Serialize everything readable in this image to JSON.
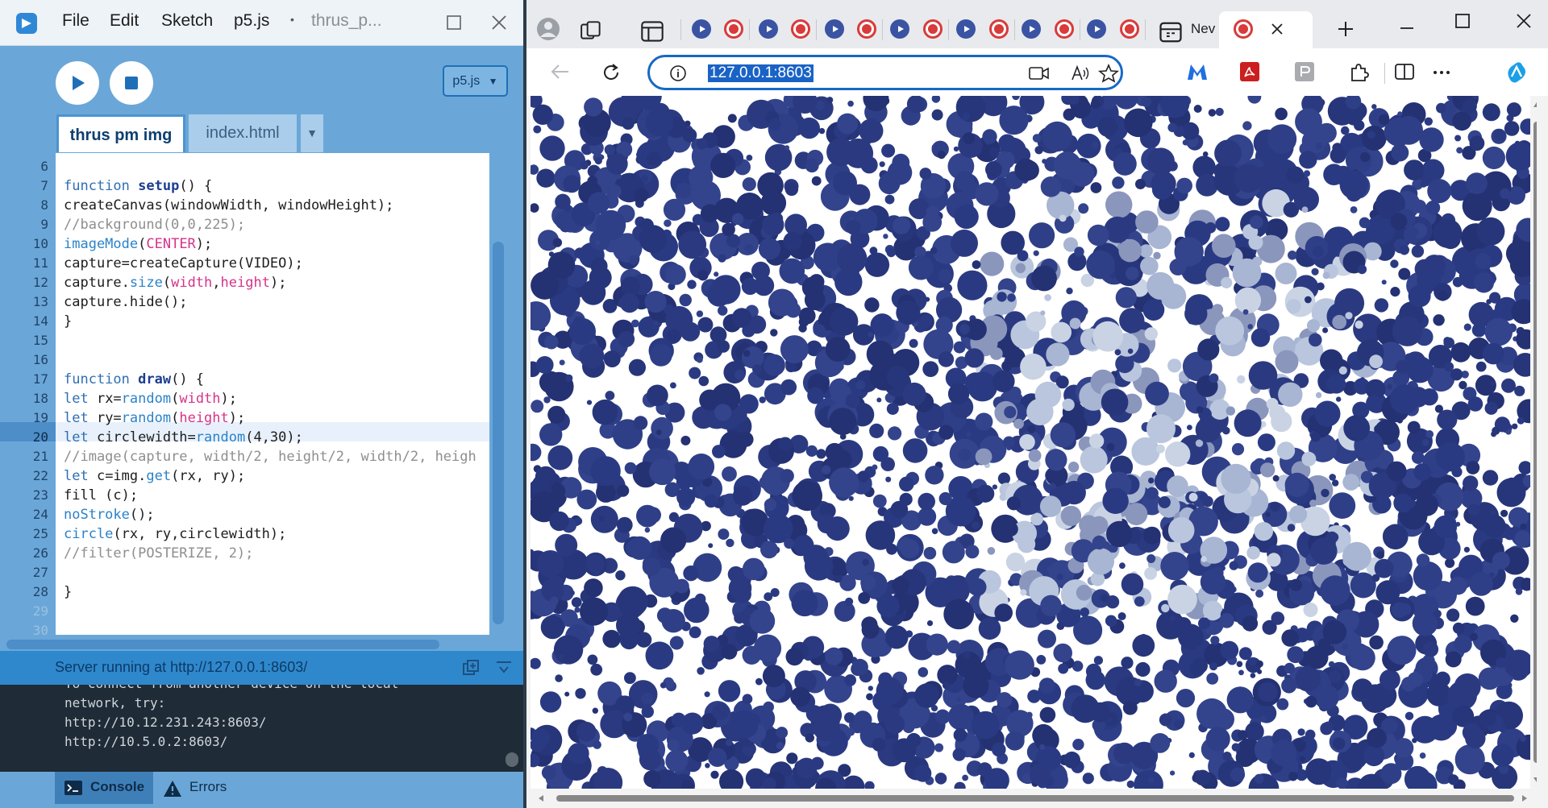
{
  "editor": {
    "menu": [
      "File",
      "Edit",
      "Sketch",
      "p5.js"
    ],
    "window_title": "thrus_p...",
    "mode": "p5.js",
    "tabs": [
      {
        "label": "thrus pm img",
        "active": true
      },
      {
        "label": "index.html",
        "active": false
      }
    ],
    "code": {
      "first_line_number": 6,
      "active_line_number": 20,
      "line_numbers": [
        "6",
        "7",
        "8",
        "9",
        "10",
        "11",
        "12",
        "13",
        "14",
        "15",
        "16",
        "17",
        "18",
        "19",
        "20",
        "21",
        "22",
        "23",
        "24",
        "25",
        "26",
        "27",
        "28",
        "29",
        "30"
      ],
      "lines": [
        "",
        "function setup() {",
        "createCanvas(windowWidth, windowHeight);",
        "//background(0,0,225);",
        "imageMode(CENTER);",
        "capture=createCapture(VIDEO);",
        "capture.size(width,height);",
        "capture.hide();",
        "}",
        "",
        "",
        "function draw() {",
        "let rx=random(width);",
        "let ry=random(height);",
        "let circlewidth=random(4,30);",
        "//image(capture, width/2, height/2, width/2, heigh",
        "let c=img.get(rx, ry);",
        "fill (c);",
        "noStroke();",
        "circle(rx, ry,circlewidth);",
        "//filter(POSTERIZE, 2);",
        "",
        "}",
        "",
        ""
      ]
    },
    "console": {
      "status": "Server running at http://127.0.0.1:8603/",
      "lines": [
        "To connect from another device on the local",
        "network, try:",
        "http://10.12.231.243:8603/",
        "http://10.5.0.2:8603/"
      ]
    },
    "footer": {
      "console_label": "Console",
      "errors_label": "Errors"
    }
  },
  "browser": {
    "active_tab_label": "Nev",
    "url": "127.0.0.1:8603",
    "canvas_colors": {
      "background": "#ffffff",
      "dominant": "#2b3a80",
      "light_tones": [
        "#b9c6dd",
        "#a8b5d3",
        "#c9d3e4",
        "#8b96bd"
      ]
    }
  },
  "colors": {
    "editor_bg": "#6aa7d8",
    "accent": "#1669c5",
    "recording_red": "#d93a3a",
    "tab_blue": "#3a53a3"
  }
}
